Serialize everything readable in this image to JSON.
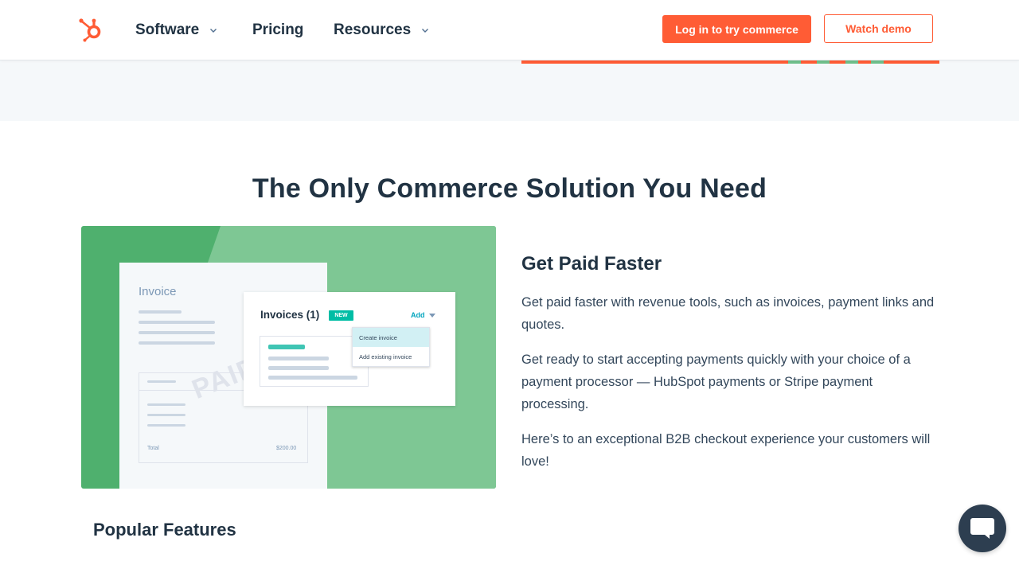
{
  "header": {
    "nav": [
      {
        "label": "Software",
        "has_dropdown": true
      },
      {
        "label": "Pricing",
        "has_dropdown": false
      },
      {
        "label": "Resources",
        "has_dropdown": true
      }
    ],
    "primary_button": "Log in to try commerce",
    "secondary_button": "Watch demo"
  },
  "colors": {
    "brand_orange": "#ff5c35",
    "dark_text": "#213343",
    "illustration_green": "#4fb06e",
    "accent_teal": "#00bda5"
  },
  "section": {
    "title": "The Only Commerce Solution You Need"
  },
  "illustration": {
    "invoice_label": "Invoice",
    "watermark": "PAID",
    "total_label": "Total",
    "total_value": "$200.00",
    "panel_title": "Invoices (1)",
    "badge": "NEW",
    "add_label": "Add",
    "menu_options": [
      "Create invoice",
      "Add existing invoice"
    ]
  },
  "feature": {
    "heading": "Get Paid Faster",
    "paragraphs": [
      "Get paid faster with revenue tools, such as invoices, payment links and quotes.",
      "Get ready to start accepting payments quickly with your choice of a payment processor — HubSpot payments or Stripe payment processing.",
      "Here’s to an exceptional B2B checkout experience your customers will love!"
    ]
  },
  "popular_features_heading": "Popular Features",
  "icons": [
    "hubspot-logo-icon",
    "chevron-down-icon",
    "chat-bubble-icon"
  ]
}
